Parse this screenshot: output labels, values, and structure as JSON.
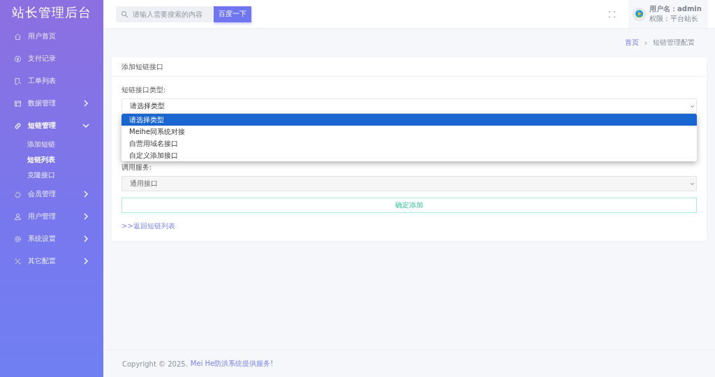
{
  "sidebar": {
    "logo": "站长管理后台",
    "items": [
      {
        "label": "用户首页",
        "active": false
      },
      {
        "label": "支付记录",
        "active": false
      },
      {
        "label": "工单列表",
        "active": false
      },
      {
        "label": "数据管理",
        "expanded": false,
        "active": false
      },
      {
        "label": "短链管理",
        "expanded": true,
        "active": true,
        "children": [
          {
            "label": "添加短链",
            "selected": false
          },
          {
            "label": "短链列表",
            "selected": true
          },
          {
            "label": "克隆接口",
            "selected": false
          }
        ]
      },
      {
        "label": "会员管理",
        "expanded": false,
        "active": false
      },
      {
        "label": "用户管理",
        "expanded": false,
        "active": false
      },
      {
        "label": "系统设置",
        "expanded": false,
        "active": false
      },
      {
        "label": "其它配置",
        "expanded": false,
        "active": false
      }
    ]
  },
  "topbar": {
    "search": {
      "placeholder": "请输入需要搜索的内容"
    },
    "search_button": "百度一下",
    "user": {
      "name": "用户名：admin",
      "role": "权限：平台站长"
    }
  },
  "breadcrumb": {
    "separator": "›",
    "items": [
      {
        "label": "首页",
        "link": true
      },
      {
        "label": "短链管理配置",
        "link": false
      }
    ]
  },
  "card": {
    "title": "添加短链接口",
    "type_field": {
      "label": "短链接口类型:",
      "value": "请选择类型",
      "dropdown_open": true,
      "options": [
        {
          "label": "请选择类型",
          "selected": true
        },
        {
          "label": "Meihe同系统对接",
          "selected": false
        },
        {
          "label": "自营用域名接口",
          "selected": false
        },
        {
          "label": "自定义添加接口",
          "selected": false
        }
      ]
    },
    "service_field": {
      "label": "调用服务:",
      "value": "通用接口"
    },
    "submit": "确定添加",
    "back_link": ">>返回短链列表"
  },
  "footer": {
    "text": "Copyright © 2025.",
    "link": "Mei He防洪系统提供服务!"
  }
}
